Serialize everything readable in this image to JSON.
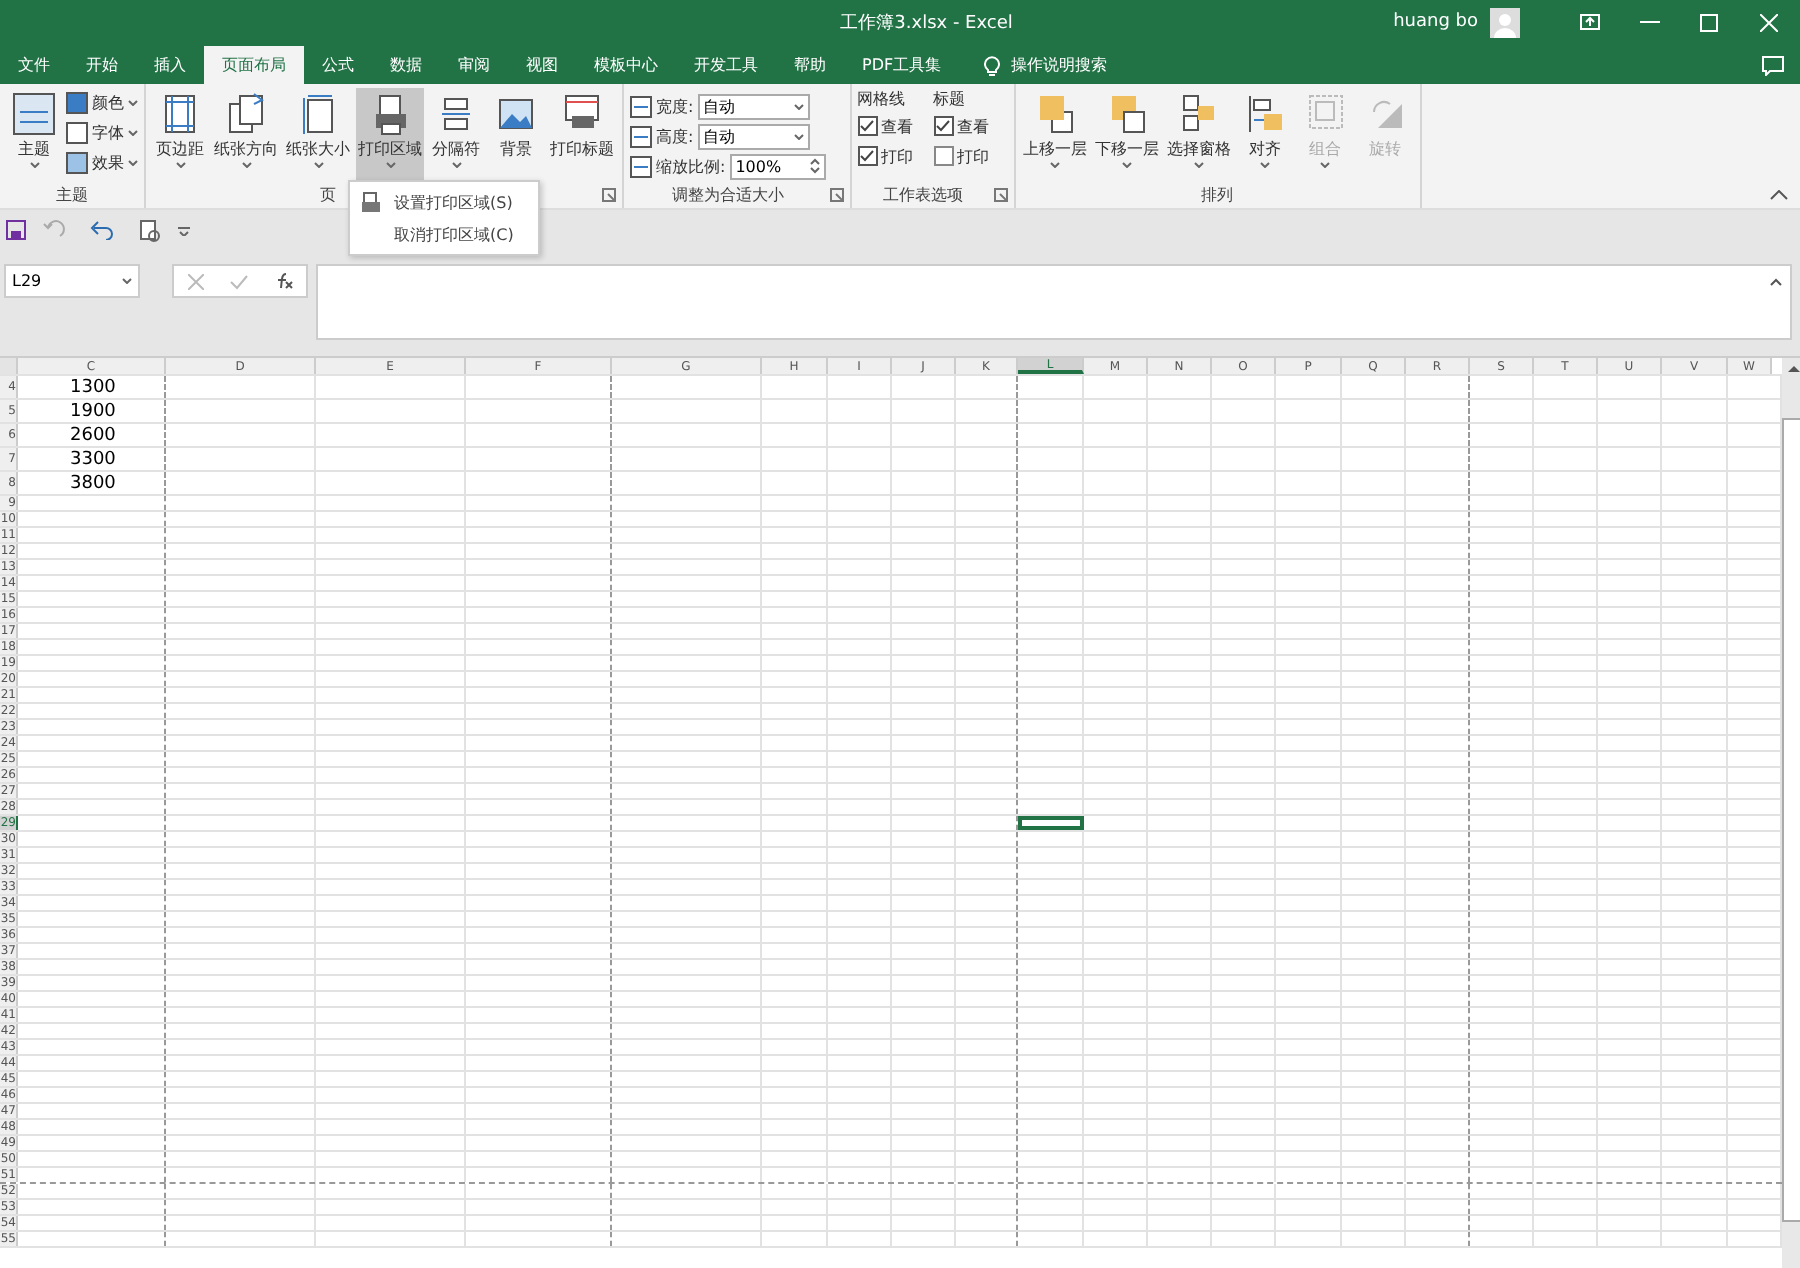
{
  "window": {
    "title": "工作簿3.xlsx  -  Excel",
    "user": "huang bo"
  },
  "tabs": [
    {
      "label": "文件",
      "selected": false
    },
    {
      "label": "开始",
      "selected": false
    },
    {
      "label": "插入",
      "selected": false
    },
    {
      "label": "页面布局",
      "selected": true
    },
    {
      "label": "公式",
      "selected": false
    },
    {
      "label": "数据",
      "selected": false
    },
    {
      "label": "审阅",
      "selected": false
    },
    {
      "label": "视图",
      "selected": false
    },
    {
      "label": "模板中心",
      "selected": false
    },
    {
      "label": "开发工具",
      "selected": false
    },
    {
      "label": "帮助",
      "selected": false
    },
    {
      "label": "PDF工具集",
      "selected": false
    }
  ],
  "tell_me": "操作说明搜索",
  "ribbon": {
    "theme_group": {
      "label": "主题",
      "big": "主题",
      "small": [
        "颜色",
        "字体",
        "效果"
      ]
    },
    "page_setup_group": {
      "label": "页",
      "buttons": [
        {
          "label": "页边距",
          "kind": "margins",
          "pressed": false
        },
        {
          "label": "纸张方向",
          "kind": "orientation",
          "pressed": false
        },
        {
          "label": "纸张大小",
          "kind": "size",
          "pressed": false
        },
        {
          "label": "打印区域",
          "kind": "printarea",
          "pressed": true
        },
        {
          "label": "分隔符",
          "kind": "breaks",
          "pressed": false
        },
        {
          "label": "背景",
          "kind": "background",
          "pressed": false
        },
        {
          "label": "打印标题",
          "kind": "titles",
          "pressed": false
        }
      ]
    },
    "fit_group": {
      "label": "调整为合适大小",
      "fields": [
        {
          "label": "宽度:",
          "value": "自动",
          "kind": "select"
        },
        {
          "label": "高度:",
          "value": "自动",
          "kind": "select"
        },
        {
          "label": "缩放比例:",
          "value": "100%",
          "kind": "spin"
        }
      ]
    },
    "sheet_options_group": {
      "label": "工作表选项",
      "columns": [
        {
          "title": "网格线",
          "options": [
            {
              "label": "查看",
              "checked": true
            },
            {
              "label": "打印",
              "checked": true
            }
          ]
        },
        {
          "title": "标题",
          "options": [
            {
              "label": "查看",
              "checked": true
            },
            {
              "label": "打印",
              "checked": false
            }
          ]
        }
      ]
    },
    "arrange_group": {
      "label": "排列",
      "buttons": [
        {
          "label": "上移一层",
          "kind": "forward",
          "disabled": false
        },
        {
          "label": "下移一层",
          "kind": "backward",
          "disabled": false
        },
        {
          "label": "选择窗格",
          "kind": "pane",
          "disabled": false
        },
        {
          "label": "对齐",
          "kind": "align",
          "disabled": false
        },
        {
          "label": "组合",
          "kind": "group",
          "disabled": true
        },
        {
          "label": "旋转",
          "kind": "rotate",
          "disabled": true
        }
      ]
    }
  },
  "print_area_menu": [
    "设置打印区域(S)",
    "取消打印区域(C)"
  ],
  "name_box": "L29",
  "columns": [
    {
      "label": "C",
      "selected": false,
      "page_break": true
    },
    {
      "label": "D",
      "selected": false,
      "page_break": false
    },
    {
      "label": "E",
      "selected": false,
      "page_break": false
    },
    {
      "label": "F",
      "selected": false,
      "page_break": true
    },
    {
      "label": "G",
      "selected": false,
      "page_break": false
    },
    {
      "label": "H",
      "selected": false,
      "page_break": false
    },
    {
      "label": "I",
      "selected": false,
      "page_break": false
    },
    {
      "label": "J",
      "selected": false,
      "page_break": false
    },
    {
      "label": "K",
      "selected": false,
      "page_break": true
    },
    {
      "label": "L",
      "selected": true,
      "page_break": false
    },
    {
      "label": "M",
      "selected": false,
      "page_break": false
    },
    {
      "label": "N",
      "selected": false,
      "page_break": false
    },
    {
      "label": "O",
      "selected": false,
      "page_break": false
    },
    {
      "label": "P",
      "selected": false,
      "page_break": false
    },
    {
      "label": "Q",
      "selected": false,
      "page_break": false
    },
    {
      "label": "R",
      "selected": false,
      "page_break": true
    },
    {
      "label": "S",
      "selected": false,
      "page_break": false
    },
    {
      "label": "T",
      "selected": false,
      "page_break": false
    },
    {
      "label": "U",
      "selected": false,
      "page_break": false
    },
    {
      "label": "V",
      "selected": false,
      "page_break": false
    },
    {
      "label": "W",
      "selected": false,
      "page_break": false
    }
  ],
  "rows": [
    {
      "label": "4",
      "selected": false,
      "page_break": false,
      "cells": [
        "1300"
      ]
    },
    {
      "label": "5",
      "selected": false,
      "page_break": false,
      "cells": [
        "1900"
      ]
    },
    {
      "label": "6",
      "selected": false,
      "page_break": false,
      "cells": [
        "2600"
      ]
    },
    {
      "label": "7",
      "selected": false,
      "page_break": false,
      "cells": [
        "3300"
      ]
    },
    {
      "label": "8",
      "selected": false,
      "page_break": false,
      "cells": [
        "3800"
      ]
    },
    {
      "label": "9",
      "selected": false,
      "page_break": false
    },
    {
      "label": "10",
      "selected": false,
      "page_break": false
    },
    {
      "label": "11",
      "selected": false,
      "page_break": false
    },
    {
      "label": "12",
      "selected": false,
      "page_break": false
    },
    {
      "label": "13",
      "selected": false,
      "page_break": false
    },
    {
      "label": "14",
      "selected": false,
      "page_break": false
    },
    {
      "label": "15",
      "selected": false,
      "page_break": false
    },
    {
      "label": "16",
      "selected": false,
      "page_break": false
    },
    {
      "label": "17",
      "selected": false,
      "page_break": false
    },
    {
      "label": "18",
      "selected": false,
      "page_break": false
    },
    {
      "label": "19",
      "selected": false,
      "page_break": false
    },
    {
      "label": "20",
      "selected": false,
      "page_break": false
    },
    {
      "label": "21",
      "selected": false,
      "page_break": false
    },
    {
      "label": "22",
      "selected": false,
      "page_break": false
    },
    {
      "label": "23",
      "selected": false,
      "page_break": false
    },
    {
      "label": "24",
      "selected": false,
      "page_break": false
    },
    {
      "label": "25",
      "selected": false,
      "page_break": false
    },
    {
      "label": "26",
      "selected": false,
      "page_break": false
    },
    {
      "label": "27",
      "selected": false,
      "page_break": false
    },
    {
      "label": "28",
      "selected": false,
      "page_break": false
    },
    {
      "label": "29",
      "selected": true,
      "page_break": false
    },
    {
      "label": "30",
      "selected": false,
      "page_break": false
    },
    {
      "label": "31",
      "selected": false,
      "page_break": false
    },
    {
      "label": "32",
      "selected": false,
      "page_break": false
    },
    {
      "label": "33",
      "selected": false,
      "page_break": false
    },
    {
      "label": "34",
      "selected": false,
      "page_break": false
    },
    {
      "label": "35",
      "selected": false,
      "page_break": false
    },
    {
      "label": "36",
      "selected": false,
      "page_break": false
    },
    {
      "label": "37",
      "selected": false,
      "page_break": false
    },
    {
      "label": "38",
      "selected": false,
      "page_break": false
    },
    {
      "label": "39",
      "selected": false,
      "page_break": false
    },
    {
      "label": "40",
      "selected": false,
      "page_break": false
    },
    {
      "label": "41",
      "selected": false,
      "page_break": false
    },
    {
      "label": "42",
      "selected": false,
      "page_break": false
    },
    {
      "label": "43",
      "selected": false,
      "page_break": false
    },
    {
      "label": "44",
      "selected": false,
      "page_break": false
    },
    {
      "label": "45",
      "selected": false,
      "page_break": false
    },
    {
      "label": "46",
      "selected": false,
      "page_break": false
    },
    {
      "label": "47",
      "selected": false,
      "page_break": false
    },
    {
      "label": "48",
      "selected": false,
      "page_break": false
    },
    {
      "label": "49",
      "selected": false,
      "page_break": false
    },
    {
      "label": "50",
      "selected": false,
      "page_break": false
    },
    {
      "label": "51",
      "selected": false,
      "page_break": true
    },
    {
      "label": "52",
      "selected": false,
      "page_break": false
    },
    {
      "label": "53",
      "selected": false,
      "page_break": false
    },
    {
      "label": "54",
      "selected": false,
      "page_break": false
    },
    {
      "label": "55",
      "selected": false,
      "page_break": false
    }
  ]
}
